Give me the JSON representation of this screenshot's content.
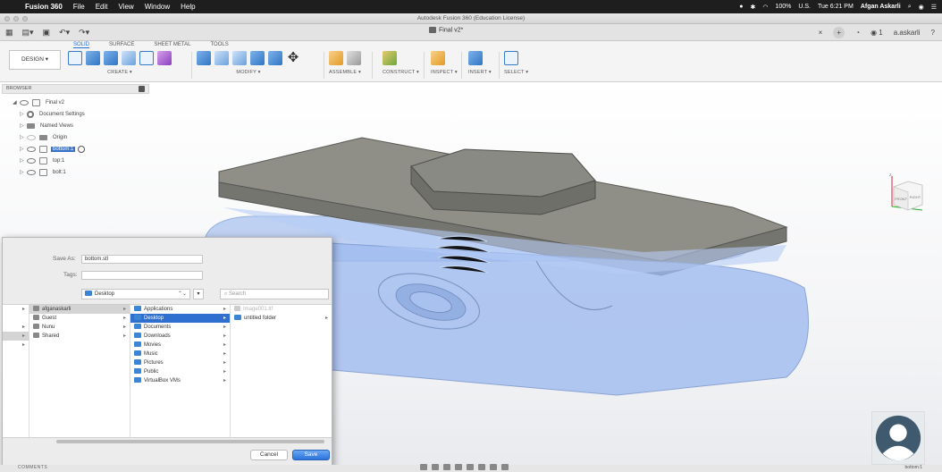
{
  "menubar": {
    "app": "Fusion 360",
    "menus": [
      "File",
      "Edit",
      "View",
      "Window",
      "Help"
    ],
    "battery": "100%",
    "input": "U.S.",
    "clock": "Tue 6:21 PM",
    "user": "Afgan Askarli"
  },
  "window": {
    "title": "Autodesk Fusion 360 (Education License)"
  },
  "doc_tab": {
    "title": "Final v2*"
  },
  "account": {
    "count": "1",
    "name": "a.askarli"
  },
  "toolbar": {
    "tabs": [
      "SOLID",
      "SURFACE",
      "SHEET METAL",
      "TOOLS"
    ],
    "workspace": "DESIGN ▾",
    "groups": {
      "create": "CREATE ▾",
      "modify": "MODIFY ▾",
      "assemble": "ASSEMBLE ▾",
      "construct": "CONSTRUCT ▾",
      "inspect": "INSPECT ▾",
      "insert": "INSERT ▾",
      "select": "SELECT ▾"
    }
  },
  "browser": {
    "title": "BROWSER",
    "root": "Final v2",
    "items": [
      "Document Settings",
      "Named Views",
      "Origin",
      "bottom:1",
      "top:1",
      "bolt:1"
    ]
  },
  "viewcube": {
    "front": "FRONT",
    "right": "RIGHT",
    "axis_z": "Z"
  },
  "save_dialog": {
    "save_as_label": "Save As:",
    "save_as_value": "bottom.stl",
    "tags_label": "Tags:",
    "location": "Desktop",
    "location_arrows": "⌃⌄",
    "new_folder_symbol": "▾",
    "search_placeholder": "Search",
    "col1": [
      "afganaskarli",
      "Guest",
      "Nunu",
      "Shared"
    ],
    "col2": [
      "Applications",
      "Desktop",
      "Documents",
      "Downloads",
      "Movies",
      "Music",
      "Pictures",
      "Public",
      "VirtualBox VMs"
    ],
    "col3": [
      "Image001.tif",
      "untitled folder"
    ],
    "cancel": "Cancel",
    "save": "Save"
  },
  "bottom": {
    "comments": "COMMENTS",
    "part_label": "bottom:1"
  },
  "colors": {
    "accent": "#2e6fd0",
    "part_blue": "#aac4f0",
    "part_gray": "#8f8f88"
  }
}
